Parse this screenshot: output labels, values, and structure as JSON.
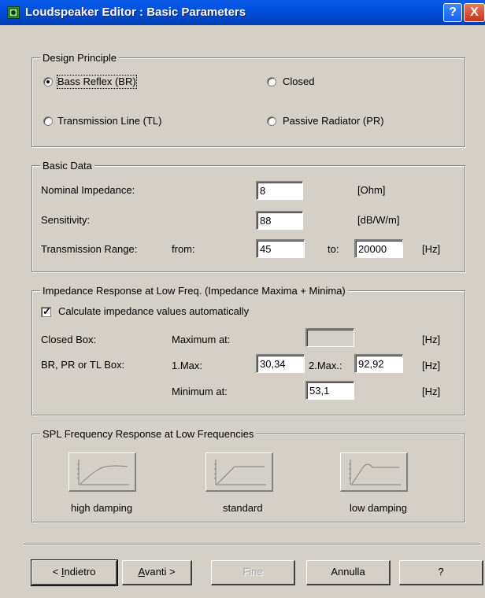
{
  "window": {
    "title": "Loudspeaker Editor :  Basic Parameters",
    "help_button": "?",
    "close_button": "X"
  },
  "design_principle": {
    "label": "Design Principle",
    "options": [
      {
        "label": "Bass Reflex (BR)",
        "selected": true
      },
      {
        "label": "Closed",
        "selected": false
      },
      {
        "label": "Transmission Line (TL)",
        "selected": false
      },
      {
        "label": "Passive Radiator (PR)",
        "selected": false
      }
    ]
  },
  "basic_data": {
    "label": "Basic Data",
    "nominal_impedance": {
      "label": "Nominal Impedance:",
      "value": "8",
      "unit": "[Ohm]"
    },
    "sensitivity": {
      "label": "Sensitivity:",
      "value": "88",
      "unit": "[dB/W/m]"
    },
    "transmission_range": {
      "label": "Transmission Range:",
      "from_label": "from:",
      "from_value": "45",
      "to_label": "to:",
      "to_value": "20000",
      "unit": "[Hz]"
    }
  },
  "impedance": {
    "label": "Impedance Response at Low Freq. (Impedance Maxima + Minima)",
    "auto_checkbox": {
      "label": "Calculate impedance values automatically",
      "checked": true
    },
    "closed_box": {
      "label": "Closed Box:",
      "max_label": "Maximum at:",
      "value": "",
      "unit": "[Hz]"
    },
    "br_box": {
      "label": "BR, PR or TL Box:",
      "max1_label": "1.Max:",
      "max1_value": "30,34",
      "max2_label": "2.Max.:",
      "max2_value": "92,92",
      "unit": "[Hz]"
    },
    "minimum": {
      "label": "Minimum at:",
      "value": "53,1",
      "unit": "[Hz]"
    }
  },
  "spl": {
    "label": "SPL Frequency Response at Low Frequencies",
    "options": [
      {
        "label": "high damping",
        "icon": "response-curve-high-damping-icon"
      },
      {
        "label": "standard",
        "icon": "response-curve-standard-icon"
      },
      {
        "label": "low damping",
        "icon": "response-curve-low-damping-icon"
      }
    ]
  },
  "buttons": {
    "back_prefix": "< ",
    "back_mnemonic": "I",
    "back_rest": "ndietro",
    "next_mnemonic": "A",
    "next_rest": "vanti >",
    "finish": "Fine",
    "cancel": "Annulla",
    "help": "?"
  }
}
